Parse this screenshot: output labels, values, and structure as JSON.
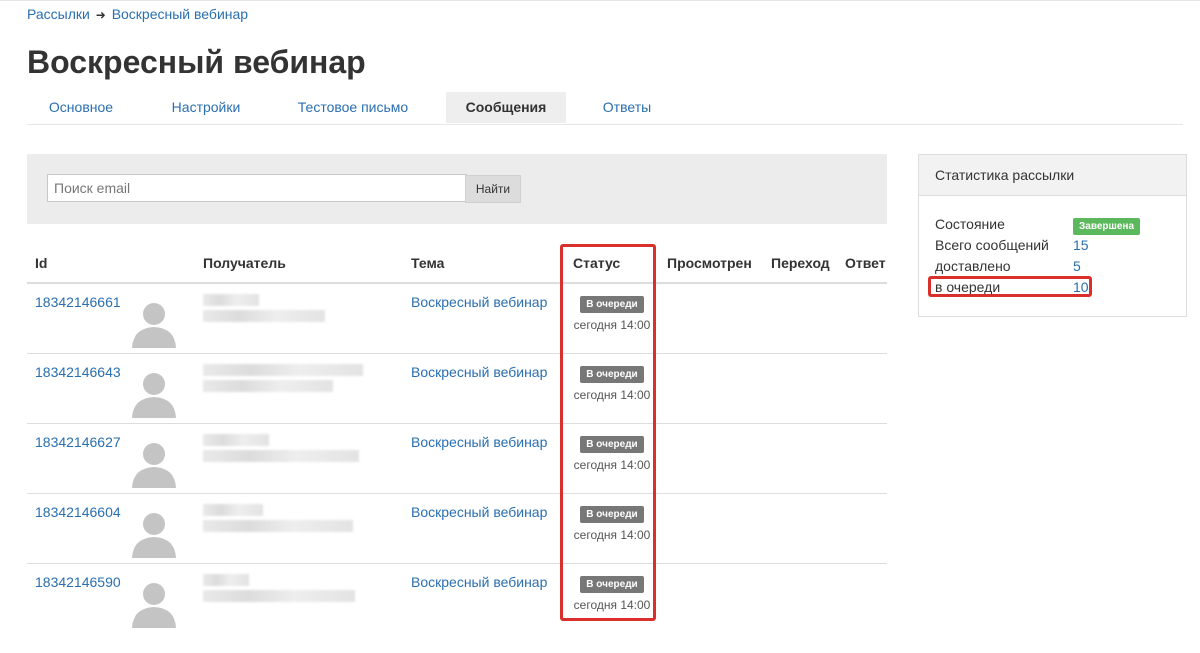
{
  "breadcrumb": {
    "root": "Рассылки",
    "separator": "➜",
    "current": "Воскресный вебинар"
  },
  "page": {
    "title": "Воскресный вебинар"
  },
  "tabs": [
    {
      "label": "Основное",
      "active": false
    },
    {
      "label": "Настройки",
      "active": false
    },
    {
      "label": "Тестовое письмо",
      "active": false
    },
    {
      "label": "Сообщения",
      "active": true
    },
    {
      "label": "Ответы",
      "active": false
    }
  ],
  "search": {
    "placeholder": "Поиск email",
    "button_label": "Найти"
  },
  "table": {
    "headers": {
      "id": "Id",
      "recipient": "Получатель",
      "subject": "Тема",
      "status": "Статус",
      "viewed": "Просмотрен",
      "clicked": "Переход",
      "reply": "Ответ"
    },
    "rows": [
      {
        "id": "18342146661",
        "subject": "Воскресный вебинар",
        "status": "В очереди",
        "time": "сегодня 14:00"
      },
      {
        "id": "18342146643",
        "subject": "Воскресный вебинар",
        "status": "В очереди",
        "time": "сегодня 14:00"
      },
      {
        "id": "18342146627",
        "subject": "Воскресный вебинар",
        "status": "В очереди",
        "time": "сегодня 14:00"
      },
      {
        "id": "18342146604",
        "subject": "Воскресный вебинар",
        "status": "В очереди",
        "time": "сегодня 14:00"
      },
      {
        "id": "18342146590",
        "subject": "Воскресный вебинар",
        "status": "В очереди",
        "time": "сегодня 14:00"
      }
    ]
  },
  "stats": {
    "title": "Статистика рассылки",
    "state_label": "Состояние",
    "state_value": "Завершена",
    "total_label": "Всего сообщений",
    "total_value": "15",
    "delivered_label": "доставлено",
    "delivered_value": "5",
    "queued_label": "в очереди",
    "queued_value": "10"
  },
  "colors": {
    "link": "#2a6fb0",
    "highlight": "#d9302c",
    "badge_queued": "#777777",
    "badge_done": "#5cb85c"
  },
  "icons": {
    "avatar": "user-silhouette-icon"
  }
}
